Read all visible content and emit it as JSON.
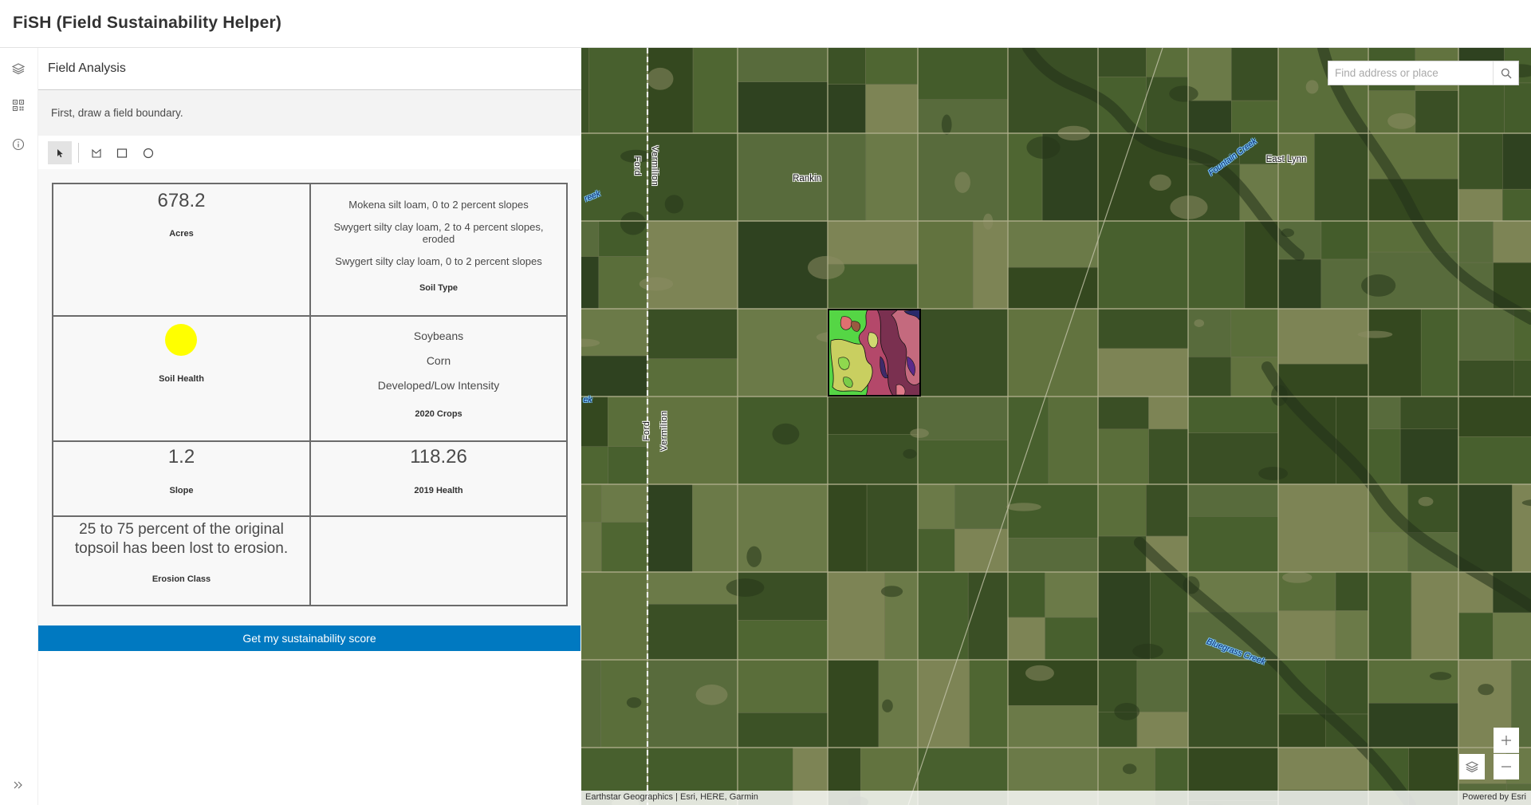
{
  "app": {
    "title": "FiSH (Field Sustainability Helper)"
  },
  "sidebar": {
    "items": [
      {
        "icon": "layers-icon"
      },
      {
        "icon": "widgets-grid-icon"
      },
      {
        "icon": "info-icon"
      }
    ],
    "expand_icon": "double-chevron-right-icon"
  },
  "panel": {
    "title": "Field Analysis",
    "instruction": "First, draw a field boundary.",
    "tools": [
      {
        "icon": "select-cursor-icon",
        "active": true
      },
      {
        "icon": "polygon-icon",
        "active": false
      },
      {
        "icon": "rectangle-icon",
        "active": false
      },
      {
        "icon": "circle-icon",
        "active": false
      }
    ],
    "results": {
      "acres": {
        "value": "678.2",
        "label": "Acres"
      },
      "soil_type": {
        "values": [
          "Mokena silt loam, 0 to 2 percent slopes",
          "Swygert silty clay loam, 2 to 4 percent slopes, eroded",
          "Swygert silty clay loam, 0 to 2 percent slopes"
        ],
        "label": "Soil Type"
      },
      "soil_health": {
        "label": "Soil Health",
        "indicator_color": "#ffff00"
      },
      "crops_2020": {
        "values": [
          "Soybeans",
          "Corn",
          "Developed/Low Intensity"
        ],
        "label": "2020 Crops"
      },
      "slope": {
        "value": "1.2",
        "label": "Slope"
      },
      "health_2019": {
        "value": "118.26",
        "label": "2019 Health"
      },
      "erosion_class": {
        "value": "25 to 75 percent of the original topsoil has been lost to erosion.",
        "label": "Erosion Class"
      }
    },
    "score_button": {
      "label": "Get my sustainability score"
    }
  },
  "map": {
    "search": {
      "placeholder": "Find address or place",
      "icon": "search-icon"
    },
    "labels": [
      "Rankin",
      "East Lynn",
      "Fountain Creek",
      "Bluegrass Creek",
      "Ford",
      "Vermilion",
      "Ford",
      "Vermilion",
      "reek",
      "ek"
    ],
    "controls": {
      "zoom_in_icon": "plus-icon",
      "zoom_out_icon": "minus-icon",
      "basemap_icon": "layers-icon"
    },
    "attribution": "Earthstar Geographics | Esri, HERE, Garmin",
    "powered_by": "Powered by Esri"
  },
  "colors": {
    "accent": "#0079c1",
    "text": "#323232",
    "soil_health_indicator": "#ffff00",
    "panel_background": "#f8f8f8"
  }
}
